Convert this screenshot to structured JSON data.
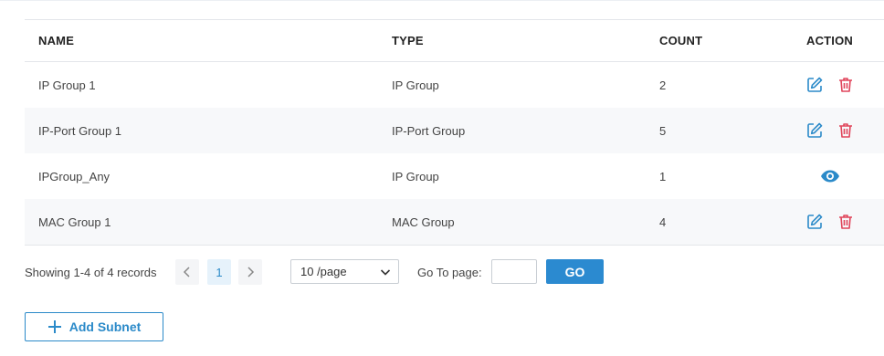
{
  "table": {
    "headers": {
      "name": "NAME",
      "type": "TYPE",
      "count": "COUNT",
      "action": "ACTION"
    },
    "rows": [
      {
        "name": "IP Group 1",
        "type": "IP Group",
        "count": "2"
      },
      {
        "name": "IP-Port Group 1",
        "type": "IP-Port Group",
        "count": "5"
      },
      {
        "name": "IPGroup_Any",
        "type": "IP Group",
        "count": "1"
      },
      {
        "name": "MAC Group 1",
        "type": "MAC Group",
        "count": "4"
      }
    ]
  },
  "pagination": {
    "summary": "Showing 1-4 of 4 records",
    "current_page": "1",
    "page_size": "10 /page",
    "goto_label": "Go To page:",
    "go_label": "GO",
    "goto_value": ""
  },
  "actions": {
    "add_subnet_label": "Add Subnet"
  },
  "colors": {
    "accent": "#2b8ac9",
    "danger": "#e0455b",
    "header_text": "#222222"
  }
}
